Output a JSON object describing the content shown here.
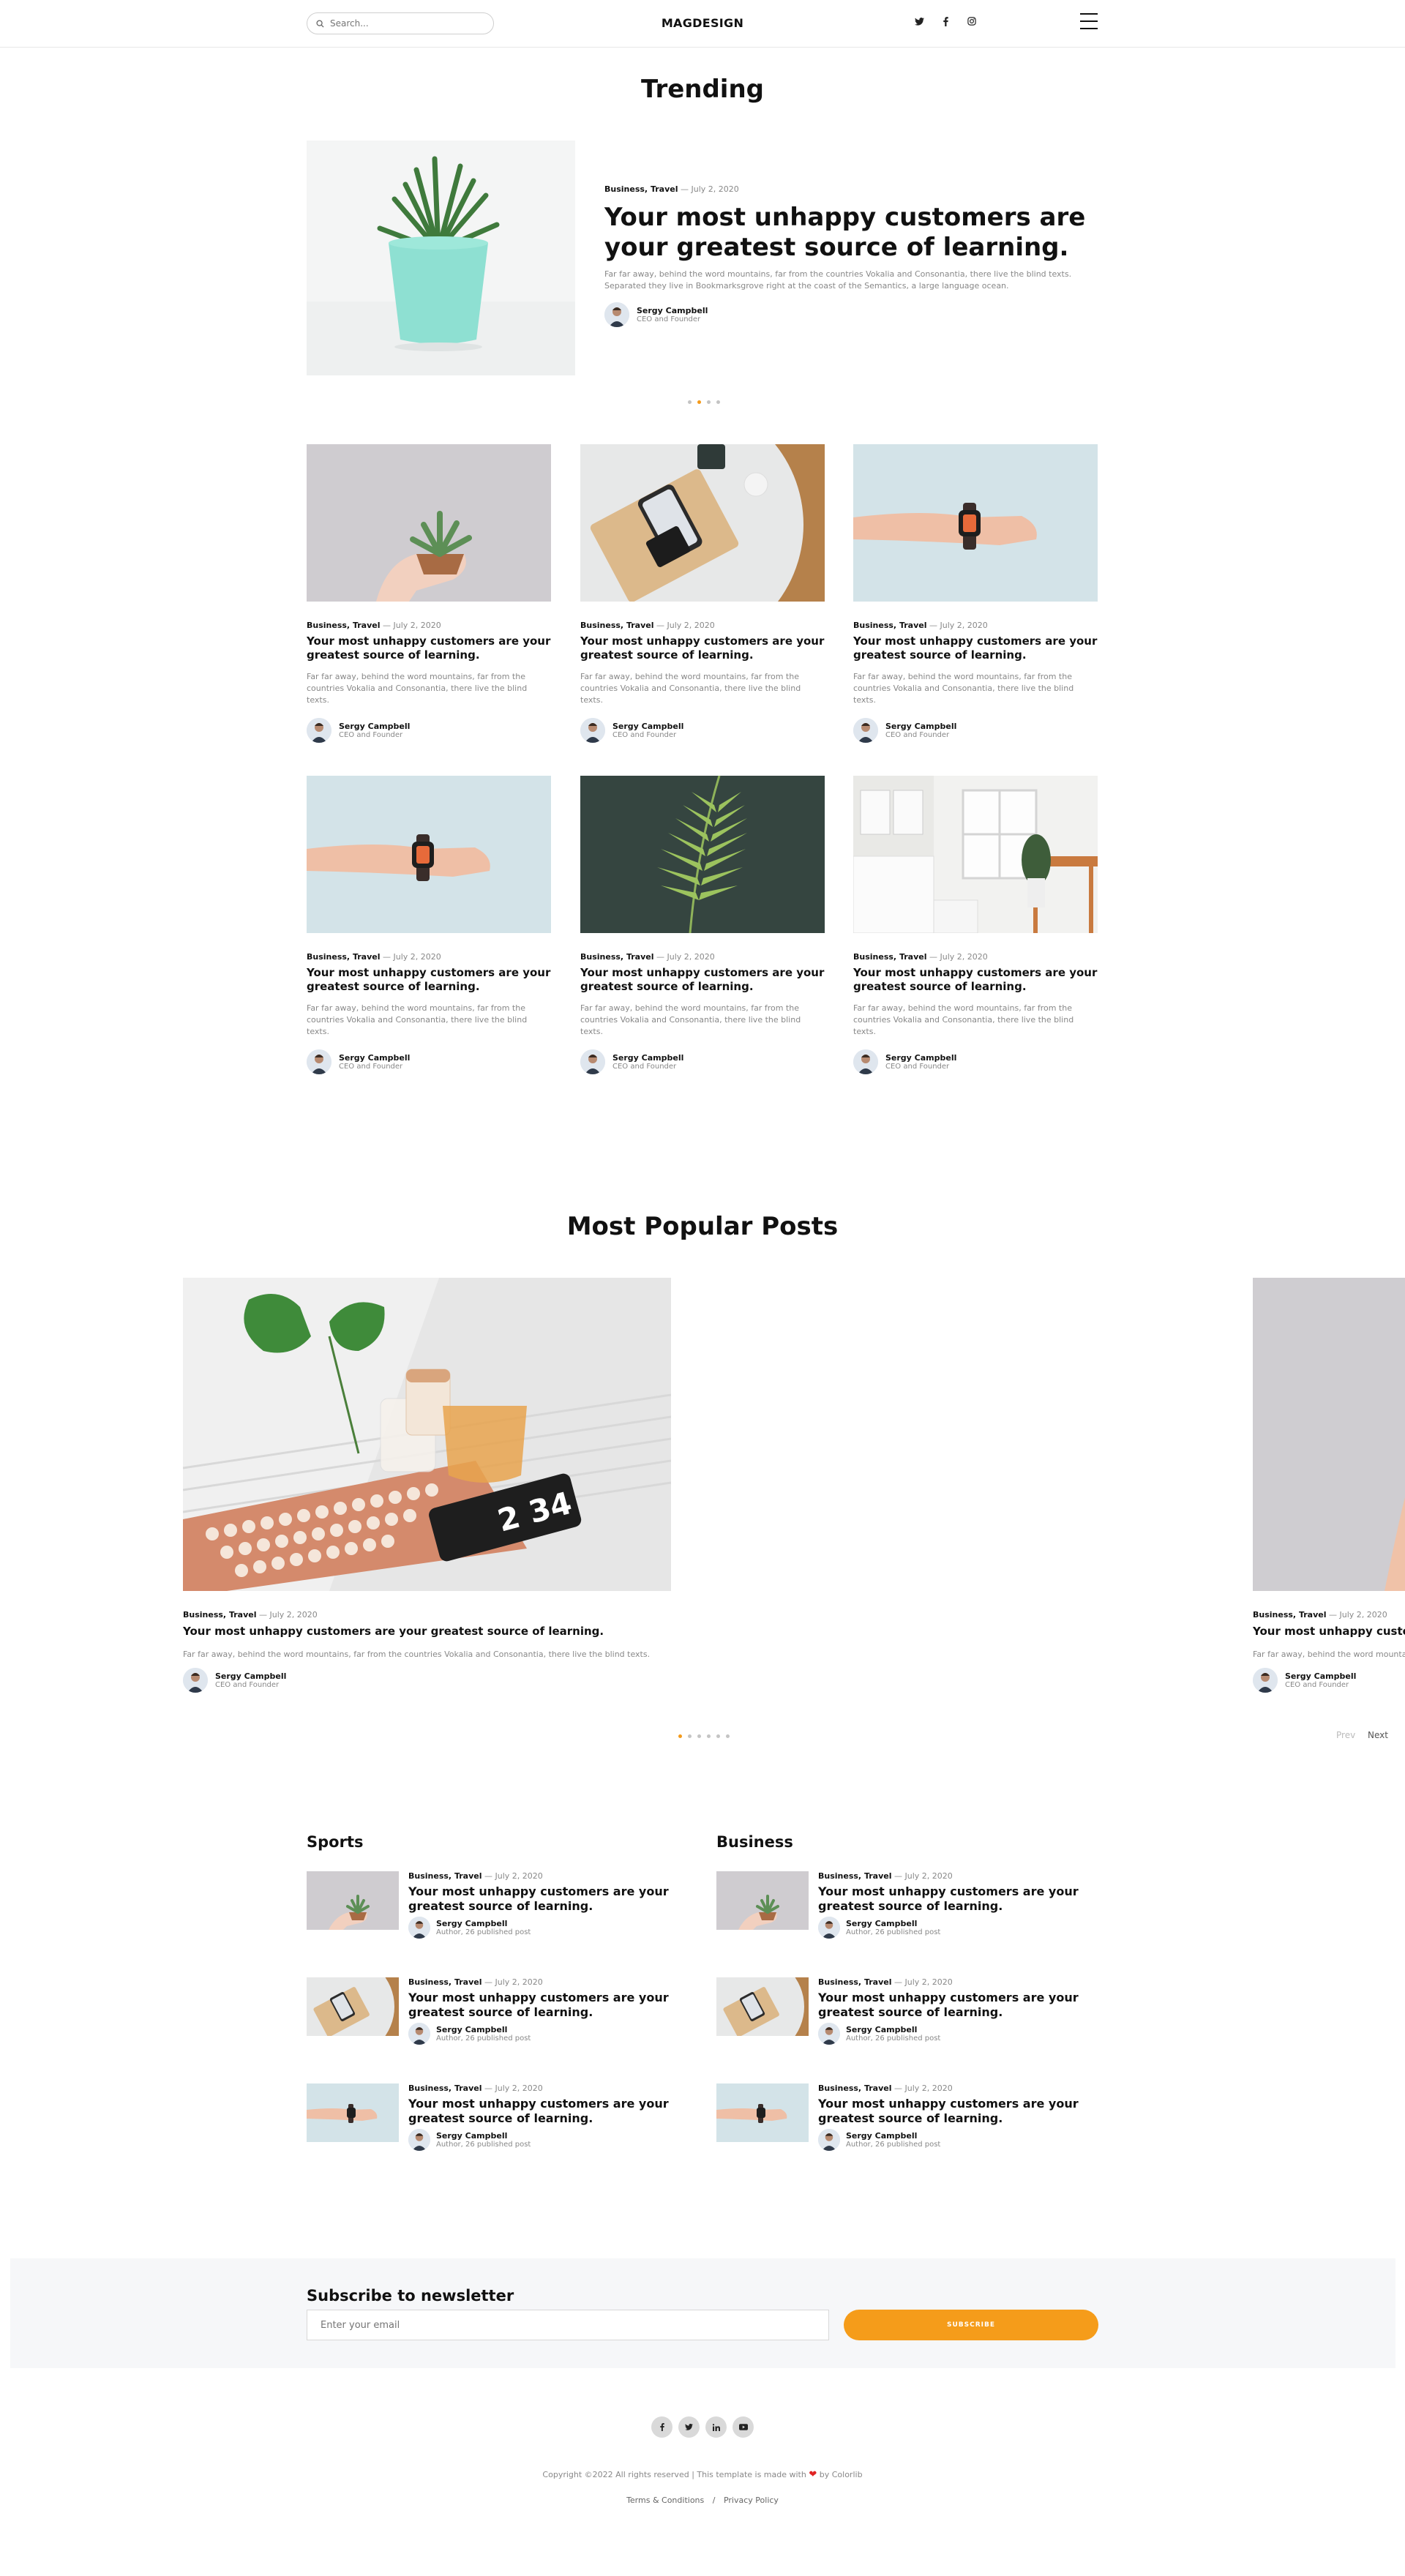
{
  "header": {
    "search_placeholder": "Search...",
    "logo": "MAGDESIGN",
    "social_icons": [
      "twitter-icon",
      "facebook-icon",
      "instagram-icon"
    ]
  },
  "trending": {
    "title": "Trending",
    "hero": {
      "cat1": "Business",
      "cat2": "Travel",
      "date": "— July 2, 2020",
      "title": "Your most unhappy customers are your greatest source of learning.",
      "excerpt": "Far far away, behind the word mountains, far from the countries Vokalia and Consonantia, there live the blind texts. Separated they live in Bookmarksgrove right at the coast of the Semantics, a large language ocean.",
      "author_name": "Sergy Campbell",
      "author_role": "CEO and Founder"
    },
    "carousel_dots": 4,
    "carousel_active": 2
  },
  "cards": [
    {
      "image": "hand-succulent",
      "cat1": "Business",
      "cat2": "Travel",
      "date": "— July 2, 2020",
      "title": "Your most unhappy customers are your greatest source of learning.",
      "excerpt": "Far far away, behind the word mountains, far from the countries Vokalia and Consonantia, there live the blind texts.",
      "author_name": "Sergy Campbell",
      "author_role": "CEO and Founder"
    },
    {
      "image": "phone-wallet-tray",
      "cat1": "Business",
      "cat2": "Travel",
      "date": "— July 2, 2020",
      "title": "Your most unhappy customers are your greatest source of learning.",
      "excerpt": "Far far away, behind the word mountains, far from the countries Vokalia and Consonantia, there live the blind texts.",
      "author_name": "Sergy Campbell",
      "author_role": "CEO and Founder"
    },
    {
      "image": "wrist-watch",
      "cat1": "Business",
      "cat2": "Travel",
      "date": "— July 2, 2020",
      "title": "Your most unhappy customers are your greatest source of learning.",
      "excerpt": "Far far away, behind the word mountains, far from the countries Vokalia and Consonantia, there live the blind texts.",
      "author_name": "Sergy Campbell",
      "author_role": "CEO and Founder"
    },
    {
      "image": "wrist-watch",
      "cat1": "Business",
      "cat2": "Travel",
      "date": "— July 2, 2020",
      "title": "Your most unhappy customers are your greatest source of learning.",
      "excerpt": "Far far away, behind the word mountains, far from the countries Vokalia and Consonantia, there live the blind texts.",
      "author_name": "Sergy Campbell",
      "author_role": "CEO and Founder"
    },
    {
      "image": "fern-leaf",
      "cat1": "Business",
      "cat2": "Travel",
      "date": "— July 2, 2020",
      "title": "Your most unhappy customers are your greatest source of learning.",
      "excerpt": "Far far away, behind the word mountains, far from the countries Vokalia and Consonantia, there live the blind texts.",
      "author_name": "Sergy Campbell",
      "author_role": "CEO and Founder"
    },
    {
      "image": "white-kitchen",
      "cat1": "Business",
      "cat2": "Travel",
      "date": "— July 2, 2020",
      "title": "Your most unhappy customers are your greatest source of learning.",
      "excerpt": "Far far away, behind the word mountains, far from the countries Vokalia and Consonantia, there live the blind texts.",
      "author_name": "Sergy Campbell",
      "author_role": "CEO and Founder"
    }
  ],
  "popular": {
    "title": "Most Popular Posts",
    "items": [
      {
        "cat1": "Business",
        "cat2": "Travel",
        "date": "— July 2, 2020",
        "title": "Your most unhappy customers are your greatest source of learning.",
        "excerpt": "Far far away, behind the word mountains, far from the countries Vokalia and Consonantia, there live the blind texts.",
        "author_name": "Sergy Campbell",
        "author_role": "CEO and Founder"
      },
      {
        "cat1": "Business",
        "cat2": "Travel",
        "date": "— July 2, 2020",
        "title": "Your most unhappy customers are your greatest source of learning.",
        "excerpt": "Far far away, behind the word mountains, far from the countries Vokalia and Consonantia, there live the blind texts.",
        "author_name": "Sergy Campbell",
        "author_role": "CEO and Founder"
      }
    ],
    "dots": 6,
    "active": 1,
    "prev": "Prev",
    "next": "Next"
  },
  "sports": {
    "title": "Sports",
    "items": [
      {
        "cat1": "Business",
        "cat2": "Travel",
        "date": "— July 2, 2020",
        "title": "Your most unhappy customers are your greatest source of learning.",
        "author_name": "Sergy Campbell",
        "author_role": "Author, 26 published post"
      },
      {
        "cat1": "Business",
        "cat2": "Travel",
        "date": "— July 2, 2020",
        "title": "Your most unhappy customers are your greatest source of learning.",
        "author_name": "Sergy Campbell",
        "author_role": "Author, 26 published post"
      },
      {
        "cat1": "Business",
        "cat2": "Travel",
        "date": "— July 2, 2020",
        "title": "Your most unhappy customers are your greatest source of learning.",
        "author_name": "Sergy Campbell",
        "author_role": "Author, 26 published post"
      }
    ]
  },
  "business": {
    "title": "Business",
    "items": [
      {
        "cat1": "Business",
        "cat2": "Travel",
        "date": "— July 2, 2020",
        "title": "Your most unhappy customers are your greatest source of learning.",
        "author_name": "Sergy Campbell",
        "author_role": "Author, 26 published post"
      },
      {
        "cat1": "Business",
        "cat2": "Travel",
        "date": "— July 2, 2020",
        "title": "Your most unhappy customers are your greatest source of learning.",
        "author_name": "Sergy Campbell",
        "author_role": "Author, 26 published post"
      },
      {
        "cat1": "Business",
        "cat2": "Travel",
        "date": "— July 2, 2020",
        "title": "Your most unhappy customers are your greatest source of learning.",
        "author_name": "Sergy Campbell",
        "author_role": "Author, 26 published post"
      }
    ]
  },
  "newsletter": {
    "title": "Subscribe to newsletter",
    "placeholder": "Enter your email",
    "button": "SUBSCRIBE"
  },
  "footer": {
    "social_icons": [
      "facebook-icon",
      "twitter-icon",
      "linkedin-icon",
      "youtube-icon"
    ],
    "copyright_pre": "Copyright ©2022 All rights reserved | This template is made with",
    "copyright_post": "by Colorlib",
    "terms": "Terms & Conditions",
    "separator": "/",
    "privacy": "Privacy Policy"
  },
  "colors": {
    "accent": "#f59c1a",
    "heart": "#e02424",
    "text": "#111111",
    "muted": "#888888"
  }
}
